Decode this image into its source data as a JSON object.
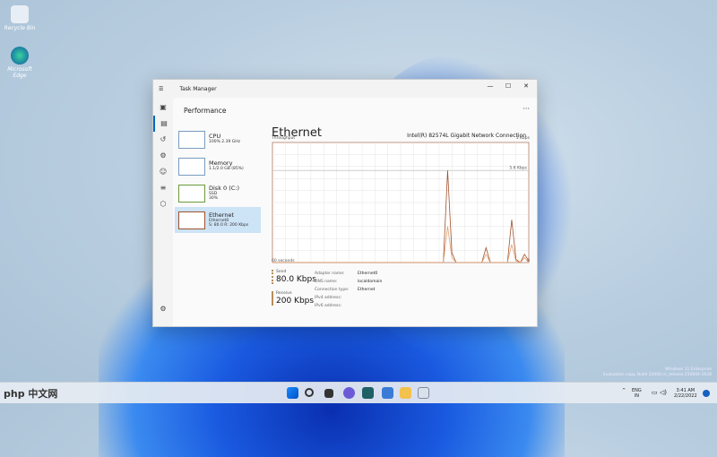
{
  "desktop": {
    "icons": [
      {
        "label": "Recycle Bin",
        "icon": "recycle-bin-icon"
      },
      {
        "label": "Microsoft Edge",
        "icon": "edge-icon"
      }
    ],
    "watermark": [
      "Windows 11 Enterprise",
      "Evaluation copy. Build 22000.rs_release.210604-1628"
    ]
  },
  "window": {
    "title": "Task Manager",
    "page_title": "Performance",
    "nav_icons": [
      "menu-icon",
      "processes-icon",
      "performance-icon",
      "app-history-icon",
      "startup-icon",
      "users-icon",
      "details-icon",
      "services-icon",
      "settings-icon"
    ],
    "resources": [
      {
        "name": "CPU",
        "line1": "100% 2.39 GHz",
        "line2": ""
      },
      {
        "name": "Memory",
        "line1": "1.1/2.0 GB (85%)",
        "line2": ""
      },
      {
        "name": "Disk 0 (C:)",
        "line1": "SSD",
        "line2": "30%"
      },
      {
        "name": "Ethernet",
        "line1": "Ethernet0",
        "line2": "S: 80.0 R: 200 Kbps"
      }
    ],
    "selected": "Ethernet",
    "main": {
      "title": "Ethernet",
      "adapter": "Intel(R) 82574L Gigabit Network Connection",
      "throughput_label": "Throughput",
      "max_label": "5 Kbps",
      "ref_label": "5.6 Kbps",
      "time_label": "60 seconds",
      "zero_label": "0",
      "send": {
        "label": "Send",
        "value": "80.0 Kbps"
      },
      "receive": {
        "label": "Receive",
        "value": "200 Kbps"
      },
      "props": [
        {
          "k": "Adapter name:",
          "v": "Ethernet0"
        },
        {
          "k": "DNS name:",
          "v": "localdomain"
        },
        {
          "k": "Connection type:",
          "v": "Ethernet"
        },
        {
          "k": "IPv4 address:",
          "v": ""
        },
        {
          "k": "IPv6 address:",
          "v": ""
        }
      ]
    }
  },
  "chart_data": {
    "type": "line",
    "title": "Throughput",
    "xlabel": "60 seconds",
    "ylabel": "Kbps",
    "xlim": [
      0,
      60
    ],
    "ylim": [
      0,
      7.3
    ],
    "grid": true,
    "x": [
      0,
      40,
      41,
      42,
      43,
      49,
      50,
      51,
      55,
      56,
      57,
      58,
      59,
      60
    ],
    "series": [
      {
        "name": "Receive",
        "color": "#a0522d",
        "values": [
          0,
          0,
          5.6,
          0.6,
          0,
          0,
          0.9,
          0,
          0,
          2.6,
          0.2,
          0,
          0.5,
          0.1
        ]
      },
      {
        "name": "Send",
        "color": "#e0a070",
        "values": [
          0,
          0,
          2.2,
          0.3,
          0,
          0,
          0.5,
          0,
          0,
          1.1,
          0.1,
          0,
          0.3,
          0
        ]
      }
    ],
    "reference_line": 5.6
  },
  "taskbar": {
    "lang1": "ENG",
    "lang2": "IN",
    "time": "3:41 AM",
    "date": "2/22/2022",
    "brand": "php 中文网",
    "apps": [
      "start-icon",
      "search-icon",
      "task-view-icon",
      "chat-icon",
      "store-icon",
      "php-app-icon",
      "file-explorer-icon",
      "task-manager-icon"
    ]
  },
  "colors": {
    "accent": "#0067c0",
    "selected": "#cde3f6",
    "grid": "#dcdcdc"
  }
}
